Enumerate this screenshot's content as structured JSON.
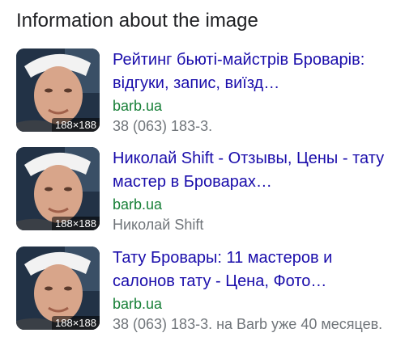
{
  "section_title": "Information about the image",
  "results": [
    {
      "title": "Рейтинг бьюті-майстрів Броварів: відгуки, запис, виїзд…",
      "domain": "barb.ua",
      "snippet": "38 (063) 183-3.",
      "thumb_size": "188×188",
      "thumb_icon": "person-photo-thumbnail"
    },
    {
      "title": "Николай Shift - Отзывы, Цены - тату мастер в Броварах…",
      "domain": "barb.ua",
      "snippet": "Николай Shift",
      "thumb_size": "188×188",
      "thumb_icon": "person-photo-thumbnail"
    },
    {
      "title": "Тату Бровары: 11 мастеров и салонов тату - Цена, Фото…",
      "domain": "barb.ua",
      "snippet": "38 (063) 183-3. на Barb уже 40 месяцев.",
      "thumb_size": "188×188",
      "thumb_icon": "person-photo-thumbnail"
    }
  ],
  "colors": {
    "title_link": "#1a0dab",
    "domain": "#188038",
    "snippet": "#70757a",
    "heading": "#202124"
  }
}
